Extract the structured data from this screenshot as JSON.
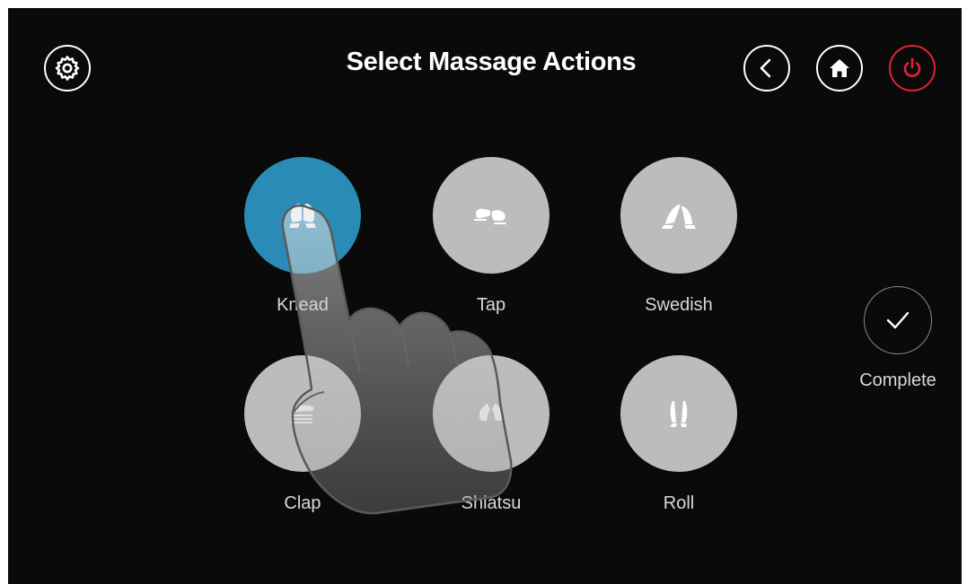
{
  "header": {
    "title": "Select Massage Actions",
    "settings_icon": "gear-icon",
    "back_icon": "chevron-left-icon",
    "home_icon": "home-icon",
    "power_icon": "power-icon",
    "power_color": "#e02433"
  },
  "actions": {
    "selected": "Knead",
    "selected_color": "#2a8cb6",
    "default_color": "#bcbcbc",
    "items": [
      {
        "label": "Knead",
        "icon": "knead-hands-icon"
      },
      {
        "label": "Tap",
        "icon": "tap-fists-icon"
      },
      {
        "label": "Swedish",
        "icon": "swedish-hands-icon"
      },
      {
        "label": "Clap",
        "icon": "clap-hand-icon"
      },
      {
        "label": "Shiatsu",
        "icon": "shiatsu-thumbs-icon"
      },
      {
        "label": "Roll",
        "icon": "roll-hands-icon"
      }
    ]
  },
  "complete": {
    "label": "Complete",
    "icon": "checkmark-icon"
  },
  "overlay": {
    "icon": "pointing-hand-icon"
  }
}
